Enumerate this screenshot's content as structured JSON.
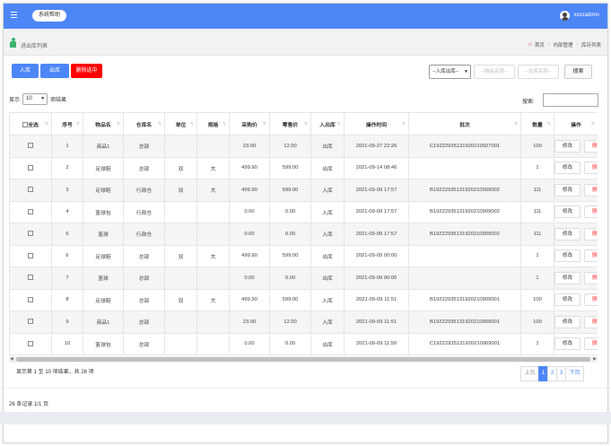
{
  "topbar": {
    "help_label": "系统帮助",
    "username": "xxxzadmin"
  },
  "crumbbar": {
    "title": "进出库列表",
    "crumbs": [
      "首页",
      "内部管理",
      "库存列表"
    ]
  },
  "toolbar": {
    "btn_in": "入库",
    "btn_out": "出库",
    "btn_delete": "删除选中",
    "type_select": "--入库出库--",
    "goods_placeholder": "--物品名称--",
    "warehouse_placeholder": "--仓库名称--",
    "search_btn": "搜索"
  },
  "length": {
    "prefix": "显示",
    "value": "10",
    "suffix": "项结果"
  },
  "search": {
    "label": "搜索:"
  },
  "table": {
    "columns": [
      "全选",
      "序号",
      "物品名",
      "仓库名",
      "单位",
      "规格",
      "采购价",
      "零售价",
      "入出库",
      "操作时间",
      "批次",
      "数量",
      "操作"
    ],
    "rows": [
      [
        "1",
        "商品1",
        "总部",
        "",
        "",
        "23.00",
        "12.00",
        "出库",
        "2021-09-27 22:26",
        "C1922293513192021092700​1",
        "100"
      ],
      [
        "2",
        "足球鞋",
        "总部",
        "双",
        "大",
        "499.90",
        "599.00",
        "出库",
        "2021-09-14 08:46",
        "",
        "1"
      ],
      [
        "3",
        "足球鞋",
        "行政仓",
        "双",
        "大",
        "499.90",
        "599.00",
        "入库",
        "2021-09-09 17:57",
        "B19222935131920210909002",
        "111"
      ],
      [
        "4",
        "篮球包",
        "行政仓",
        "",
        "",
        "0.00",
        "0.00",
        "入库",
        "2021-09-09 17:57",
        "B19222935131920210909002",
        "111"
      ],
      [
        "5",
        "篮球",
        "行政仓",
        "",
        "",
        "0.00",
        "0.00",
        "入库",
        "2021-09-09 17:57",
        "B19222935131920210909002",
        "111"
      ],
      [
        "6",
        "足球鞋",
        "总部",
        "双",
        "大",
        "499.90",
        "599.00",
        "出库",
        "2021-09-09 00:00",
        "",
        "1"
      ],
      [
        "7",
        "篮球",
        "总部",
        "",
        "",
        "0.00",
        "0.00",
        "出库",
        "2021-09-09 00:00",
        "",
        "1"
      ],
      [
        "8",
        "足球鞋",
        "总部",
        "双",
        "大",
        "499.90",
        "599.00",
        "入库",
        "2021-09-09 11:51",
        "B19222935131920210909001",
        "100"
      ],
      [
        "9",
        "商品1",
        "总部",
        "",
        "",
        "23.00",
        "12.00",
        "入库",
        "2021-09-09 11:51",
        "B19222935131920210909001",
        "100"
      ],
      [
        "10",
        "篮球包",
        "总部",
        "",
        "",
        "0.00",
        "0.00",
        "出库",
        "2021-09-09 11:50",
        "C19222935131920210909001",
        "1"
      ]
    ],
    "edit_label": "修改",
    "delete_label": "删除"
  },
  "info": "显示第 1 至 10 项结果，共 26 项",
  "pager": {
    "prev": "上页",
    "pages": [
      "1",
      "2",
      "3"
    ],
    "next": "下页",
    "active": "1"
  },
  "summary": "26 条记录 1/1 页",
  "colors": {
    "accent": "#4d86f7",
    "danger": "#ff0000"
  }
}
